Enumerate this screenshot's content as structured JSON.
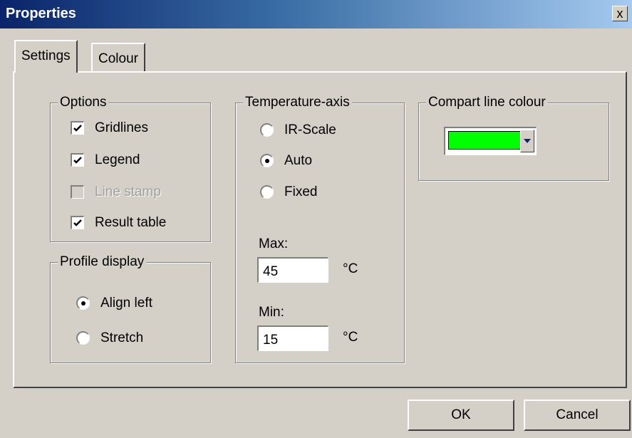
{
  "window": {
    "title": "Properties",
    "close_label": "x"
  },
  "tabs": [
    {
      "label": "Settings",
      "active": true
    },
    {
      "label": "Colour",
      "active": false
    }
  ],
  "options": {
    "label": "Options",
    "items": [
      {
        "label": "Gridlines",
        "checked": true,
        "enabled": true
      },
      {
        "label": "Legend",
        "checked": true,
        "enabled": true
      },
      {
        "label": "Line stamp",
        "checked": false,
        "enabled": false
      },
      {
        "label": "Result table",
        "checked": true,
        "enabled": true
      }
    ]
  },
  "profile_display": {
    "label": "Profile display",
    "items": [
      {
        "label": "Align left",
        "selected": true
      },
      {
        "label": "Stretch",
        "selected": false
      }
    ]
  },
  "temperature_axis": {
    "label": "Temperature-axis",
    "items": [
      {
        "label": "IR-Scale",
        "selected": false
      },
      {
        "label": "Auto",
        "selected": true
      },
      {
        "label": "Fixed",
        "selected": false
      }
    ],
    "max_label": "Max:",
    "max_value": "45",
    "min_label": "Min:",
    "min_value": "15",
    "unit": "°C"
  },
  "compart_line_colour": {
    "label": "Compart line colour",
    "color": "#00ff00"
  },
  "buttons": {
    "ok": "OK",
    "cancel": "Cancel"
  }
}
